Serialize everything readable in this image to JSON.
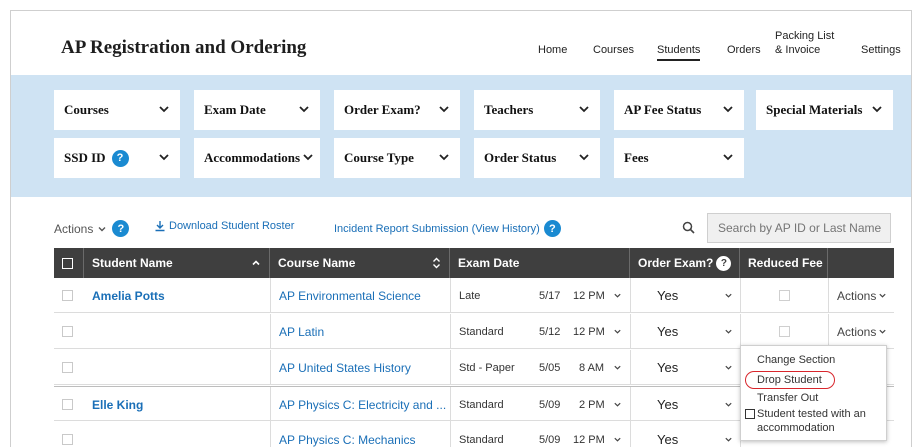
{
  "app": {
    "title": "AP Registration and Ordering"
  },
  "nav": {
    "home": "Home",
    "courses": "Courses",
    "students": "Students",
    "orders": "Orders",
    "packing_line1": "Packing List",
    "packing_line2": "& Invoice",
    "settings": "Settings"
  },
  "filters": {
    "courses": "Courses",
    "exam_date": "Exam Date",
    "order_exam": "Order Exam?",
    "teachers": "Teachers",
    "ap_fee_status": "AP Fee Status",
    "special_materials": "Special Materials",
    "ssd_id": "SSD ID",
    "accommodations": "Accommodations",
    "course_type": "Course Type",
    "order_status": "Order Status",
    "fees": "Fees"
  },
  "toolbar": {
    "actions": "Actions",
    "download": "Download Student Roster",
    "incident": "Incident Report Submission (View History)",
    "search_placeholder": "Search by AP ID or Last Name"
  },
  "table": {
    "headers": {
      "student": "Student Name",
      "course": "Course Name",
      "exam_date": "Exam Date",
      "order_exam": "Order Exam?",
      "reduced_fee": "Reduced Fee"
    },
    "rows": [
      {
        "student": "Amelia Potts",
        "course": "AP Environmental Science",
        "type": "Late",
        "date": "5/17",
        "time": "12 PM",
        "order": "Yes",
        "action": "Actions"
      },
      {
        "student": "",
        "course": "AP Latin",
        "type": "Standard",
        "date": "5/12",
        "time": "12 PM",
        "order": "Yes",
        "action": "Actions"
      },
      {
        "student": "",
        "course": "AP United States History",
        "type": "Std - Paper",
        "date": "5/05",
        "time": "8 AM",
        "order": "Yes",
        "action": ""
      },
      {
        "student": "Elle King",
        "course": "AP Physics C: Electricity and ...",
        "type": "Standard",
        "date": "5/09",
        "time": "2 PM",
        "order": "Yes",
        "action": ""
      },
      {
        "student": "",
        "course": "AP Physics C: Mechanics",
        "type": "Standard",
        "date": "5/09",
        "time": "12 PM",
        "order": "Yes",
        "action": ""
      }
    ]
  },
  "popup": {
    "change_section": "Change Section",
    "drop_student": "Drop Student",
    "transfer_out": "Transfer Out",
    "tested_line1": "Student tested with an",
    "tested_line2": "accommodation"
  },
  "colors": {
    "accent": "#1a8ad1",
    "filter_band": "#cfe3f3",
    "header_dark": "#3f3f3f",
    "highlight": "#d8262c"
  }
}
